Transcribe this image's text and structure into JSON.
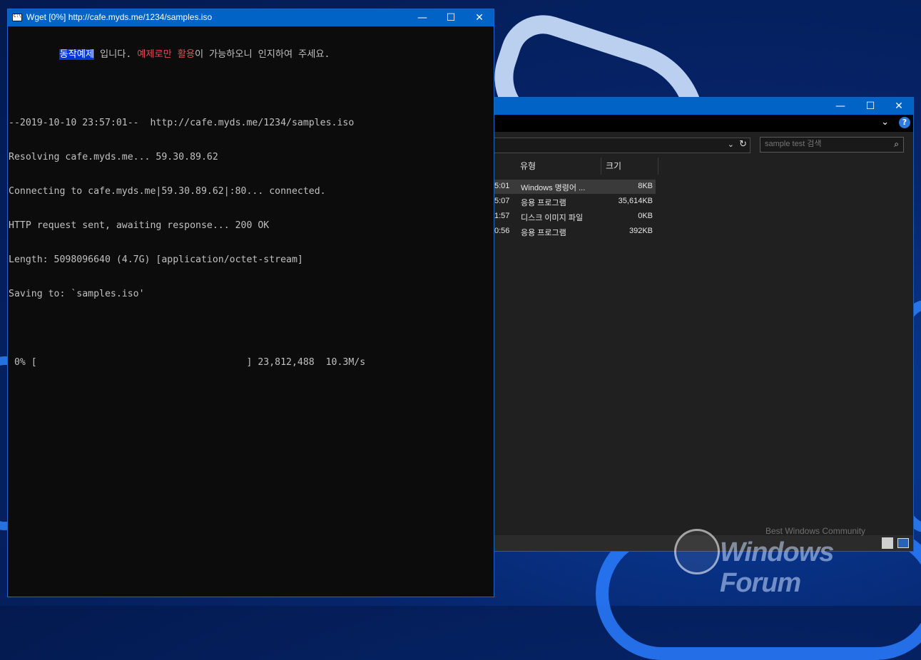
{
  "explorer": {
    "search_placeholder": "sample test 검색",
    "columns": [
      "유형",
      "크기"
    ],
    "rows": [
      {
        "date": "5:01",
        "type": "Windows 명령어 ...",
        "size": "8KB",
        "selected": true
      },
      {
        "date": "5:07",
        "type": "응용 프로그램",
        "size": "35,614KB",
        "selected": false
      },
      {
        "date": "1:57",
        "type": "디스크 이미지 파일",
        "size": "0KB",
        "selected": false
      },
      {
        "date": "0:56",
        "type": "응용 프로그램",
        "size": "392KB",
        "selected": false
      }
    ],
    "controls": {
      "minimize": "—",
      "maximize": "☐",
      "close": "✕"
    }
  },
  "console": {
    "title": "Wget [0%] http://cafe.myds.me/1234/samples.iso",
    "controls": {
      "minimize": "—",
      "maximize": "☐",
      "close": "✕"
    },
    "line1": {
      "indent": "         ",
      "selected": "동작예제",
      "mid": " 입니다. ",
      "red1": "예제로만 활용",
      "tail": "이 가능하오니 인지하여 주세요."
    },
    "lines": [
      "",
      "--2019-10-10 23:57:01--  http://cafe.myds.me/1234/samples.iso",
      "Resolving cafe.myds.me... 59.30.89.62",
      "Connecting to cafe.myds.me|59.30.89.62|:80... connected.",
      "HTTP request sent, awaiting response... 200 OK",
      "Length: 5098096640 (4.7G) [application/octet-stream]",
      "Saving to: `samples.iso'",
      "",
      " 0% [                                     ] 23,812,488  10.3M/s"
    ]
  },
  "watermark": {
    "text": "Windows Forum",
    "sub": "Best Windows Community"
  }
}
